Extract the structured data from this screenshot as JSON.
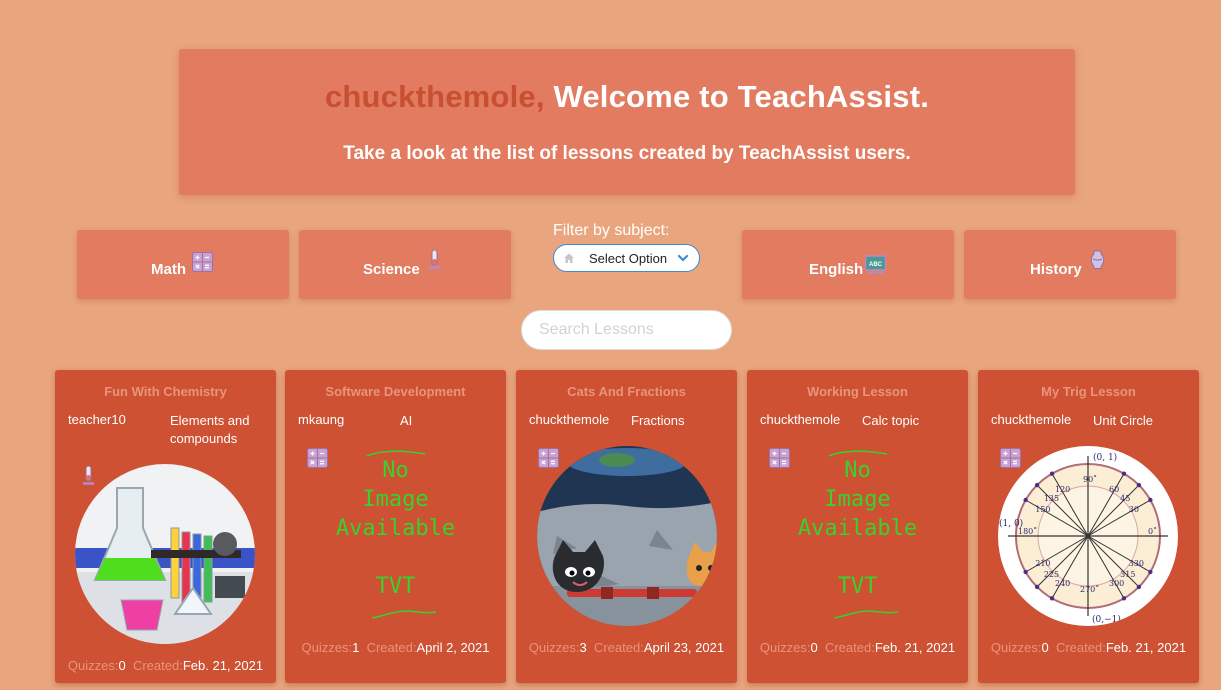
{
  "welcome": {
    "username": "chuckthemole,",
    "title": " Welcome to TeachAssist.",
    "subtitle": "Take a look at the list of lessons created by TeachAssist users."
  },
  "subjects": {
    "math": {
      "label": "Math",
      "icon": "calculator-icon"
    },
    "science": {
      "label": "Science",
      "icon": "test-tube-icon"
    },
    "english": {
      "label": "English",
      "icon": "chalkboard-icon"
    },
    "history": {
      "label": "History",
      "icon": "vase-icon"
    }
  },
  "filter": {
    "label": "Filter by subject:",
    "selected": "Select Option",
    "accent": "#3a8bd6"
  },
  "search": {
    "placeholder": "Search Lessons"
  },
  "no_image": {
    "line1": "No",
    "line2": "Image",
    "line3": "Available",
    "tag": "TVT",
    "color": "#39d12d"
  },
  "lessons": [
    {
      "title": "Fun With Chemistry",
      "author": "teacher10",
      "topic": "Elements and compounds",
      "quizzes_label": "Quizzes:",
      "quizzes": "0",
      "created_label": "Created:",
      "created": "Feb. 21, 2021",
      "subject_icon": "test-tube-icon"
    },
    {
      "title": "Software Development",
      "author": "mkaung",
      "topic": "AI",
      "quizzes_label": "Quizzes:",
      "quizzes": "1",
      "created_label": "Created:",
      "created": "April 2, 2021",
      "subject_icon": "calculator-icon"
    },
    {
      "title": "Cats And Fractions",
      "author": "chuckthemole",
      "topic": "Fractions",
      "quizzes_label": "Quizzes:",
      "quizzes": "3",
      "created_label": "Created:",
      "created": "April 23, 2021",
      "subject_icon": "calculator-icon"
    },
    {
      "title": "Working Lesson",
      "author": "chuckthemole",
      "topic": "Calc topic",
      "quizzes_label": "Quizzes:",
      "quizzes": "0",
      "created_label": "Created:",
      "created": "Feb. 21, 2021",
      "subject_icon": "calculator-icon"
    },
    {
      "title": "My Trig Lesson",
      "author": "chuckthemole",
      "topic": "Unit Circle",
      "quizzes_label": "Quizzes:",
      "quizzes": "0",
      "created_label": "Created:",
      "created": "Feb. 21, 2021",
      "subject_icon": "calculator-icon"
    }
  ],
  "unit_circle": {
    "axis_labels": [
      "(0, 1)",
      "(1, 0)",
      "(0,−1)",
      "0˚",
      "90˚",
      "180˚",
      "270˚"
    ],
    "angles_deg": [
      "30",
      "45",
      "60",
      "120",
      "135",
      "150",
      "210",
      "225",
      "240",
      "300",
      "315",
      "330"
    ]
  },
  "colors": {
    "page_bg": "#e9a57d",
    "hero_bg": "#e27b5f",
    "card_bg": "#cd5132",
    "username": "#c84f32",
    "muted": "#e9947a"
  }
}
